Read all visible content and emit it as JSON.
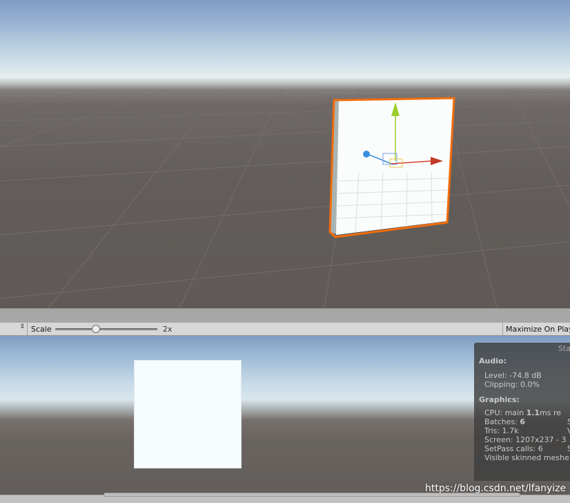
{
  "game_toolbar": {
    "display_arrow": "⇕",
    "scale_label": "Scale",
    "scale_value": "2x",
    "scale_fraction": 0.4,
    "maximize_label": "Maximize On Play"
  },
  "stats": {
    "title": "Sta",
    "audio": {
      "heading": "Audio:",
      "level": "Level: -74.8 dB",
      "clipping": "Clipping: 0.0%"
    },
    "graphics": {
      "heading": "Graphics:",
      "cpu_prefix": "CPU: main ",
      "cpu_value": "1.1",
      "cpu_suffix": "ms  re",
      "batches_label": "Batches: ",
      "batches_value": "6",
      "batches_col2": "S",
      "tris": "Tris: 1.7k",
      "tris_col2": "V",
      "screen": "Screen: 1207x237 - 3",
      "setpass": "SetPass calls: 6",
      "setpass_col2": "S",
      "skinned": "Visible skinned meshe"
    }
  },
  "watermark": "https://blog.csdn.net/lfanyize",
  "colors": {
    "selection_outline": "#f26d0c",
    "gizmo_y": "#9ccc2a",
    "gizmo_x": "#d0402a",
    "gizmo_z": "#3a8fe0"
  }
}
